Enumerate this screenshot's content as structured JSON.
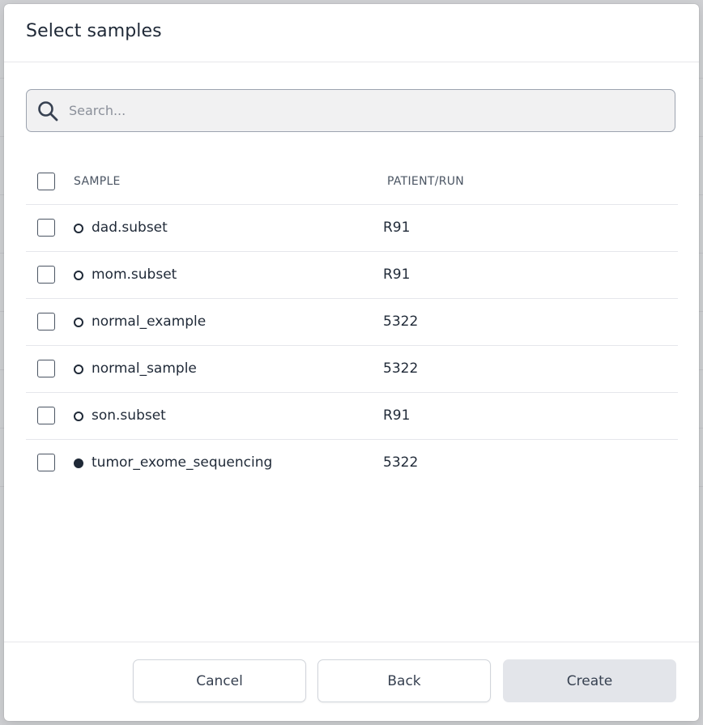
{
  "dialog": {
    "title": "Select samples"
  },
  "search": {
    "placeholder": "Search...",
    "value": ""
  },
  "table": {
    "columns": {
      "sample": "SAMPLE",
      "patient_run": "PATIENT/RUN"
    },
    "rows": [
      {
        "name": "dad.subset",
        "run": "R91",
        "status": "hollow"
      },
      {
        "name": "mom.subset",
        "run": "R91",
        "status": "hollow"
      },
      {
        "name": "normal_example",
        "run": "5322",
        "status": "hollow"
      },
      {
        "name": "normal_sample",
        "run": "5322",
        "status": "hollow"
      },
      {
        "name": "son.subset",
        "run": "R91",
        "status": "hollow"
      },
      {
        "name": "tumor_exome_sequencing",
        "run": "5322",
        "status": "filled"
      }
    ]
  },
  "footer": {
    "cancel_label": "Cancel",
    "back_label": "Back",
    "create_label": "Create"
  },
  "colors": {
    "text": "#1f2937",
    "border": "#e5e7eb",
    "disabled_button": "#e3e5ea"
  },
  "icons": {
    "search": "search-icon",
    "status_dot": "status-dot-icon"
  }
}
